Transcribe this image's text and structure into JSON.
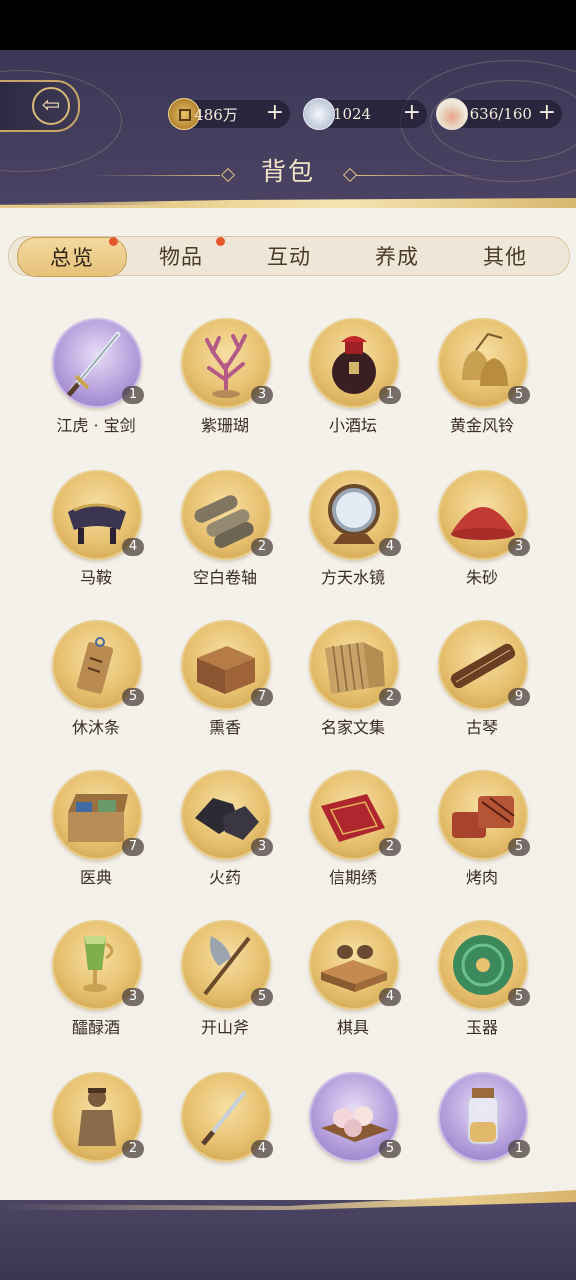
{
  "header": {
    "title": "背包",
    "currencies": [
      {
        "icon": "copper-coin-icon",
        "value": "486万",
        "plus": "+"
      },
      {
        "icon": "silver-ingot-icon",
        "value": "1024",
        "plus": "+"
      },
      {
        "icon": "food-bowl-icon",
        "value": "1636/160",
        "plus": "+"
      }
    ]
  },
  "tabs": [
    {
      "label": "总览",
      "active": true,
      "dot": true
    },
    {
      "label": "物品",
      "active": false,
      "dot": true
    },
    {
      "label": "互动",
      "active": false,
      "dot": false
    },
    {
      "label": "养成",
      "active": false,
      "dot": false
    },
    {
      "label": "其他",
      "active": false,
      "dot": false
    }
  ],
  "items": [
    {
      "name": "江虎 · 宝剑",
      "count": "1",
      "icon": "sword-icon",
      "bg": "purple"
    },
    {
      "name": "紫珊瑚",
      "count": "3",
      "icon": "coral-icon",
      "bg": "gold"
    },
    {
      "name": "小酒坛",
      "count": "1",
      "icon": "wine-jar-icon",
      "bg": "gold"
    },
    {
      "name": "黄金风铃",
      "count": "5",
      "icon": "golden-bells-icon",
      "bg": "gold"
    },
    {
      "name": "马鞍",
      "count": "4",
      "icon": "saddle-icon",
      "bg": "gold"
    },
    {
      "name": "空白卷轴",
      "count": "2",
      "icon": "scrolls-icon",
      "bg": "gold"
    },
    {
      "name": "方天水镜",
      "count": "4",
      "icon": "mirror-icon",
      "bg": "gold"
    },
    {
      "name": "朱砂",
      "count": "3",
      "icon": "cinnabar-icon",
      "bg": "gold"
    },
    {
      "name": "休沐条",
      "count": "5",
      "icon": "wooden-tag-icon",
      "bg": "gold"
    },
    {
      "name": "熏香",
      "count": "7",
      "icon": "incense-box-icon",
      "bg": "gold"
    },
    {
      "name": "名家文集",
      "count": "2",
      "icon": "bamboo-book-icon",
      "bg": "gold"
    },
    {
      "name": "古琴",
      "count": "9",
      "icon": "guqin-icon",
      "bg": "gold"
    },
    {
      "name": "医典",
      "count": "7",
      "icon": "medicine-chest-icon",
      "bg": "gold"
    },
    {
      "name": "火药",
      "count": "3",
      "icon": "gunpowder-icon",
      "bg": "gold"
    },
    {
      "name": "信期绣",
      "count": "2",
      "icon": "embroidery-icon",
      "bg": "gold"
    },
    {
      "name": "烤肉",
      "count": "5",
      "icon": "roast-meat-icon",
      "bg": "gold"
    },
    {
      "name": "醽醁酒",
      "count": "3",
      "icon": "wine-cup-icon",
      "bg": "gold"
    },
    {
      "name": "开山斧",
      "count": "5",
      "icon": "axe-icon",
      "bg": "gold"
    },
    {
      "name": "棋具",
      "count": "4",
      "icon": "go-board-icon",
      "bg": "gold"
    },
    {
      "name": "玉器",
      "count": "5",
      "icon": "jade-disc-icon",
      "bg": "gold"
    },
    {
      "name": "",
      "count": "2",
      "icon": "statue-icon",
      "bg": "gold"
    },
    {
      "name": "",
      "count": "4",
      "icon": "dagger-icon",
      "bg": "gold"
    },
    {
      "name": "",
      "count": "5",
      "icon": "cake-icon",
      "bg": "purple"
    },
    {
      "name": "",
      "count": "1",
      "icon": "jar-icon",
      "bg": "purple"
    }
  ]
}
